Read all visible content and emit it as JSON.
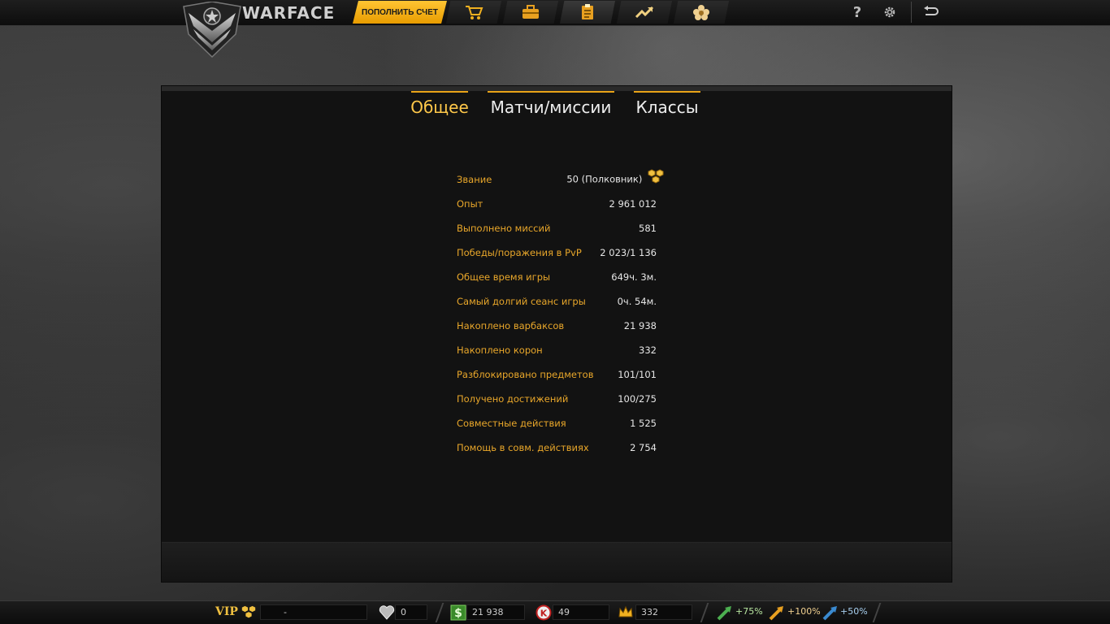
{
  "header": {
    "logo_text": "WARFACE",
    "topup_label": "ПОПОЛНИТЬ СЧЕТ",
    "nav_icons": [
      "cart-icon",
      "toolbox-icon",
      "clipboard-icon",
      "trend-icon",
      "flower-icon"
    ],
    "help_label": "?",
    "accent_color": "#f5a800"
  },
  "tabs": [
    {
      "label": "Общее",
      "active": true
    },
    {
      "label": "Матчи/миссии",
      "active": false
    },
    {
      "label": "Классы",
      "active": false
    }
  ],
  "stats": [
    {
      "label": "Звание",
      "value": "50 (Полковник)"
    },
    {
      "label": "Опыт",
      "value": "2 961 012"
    },
    {
      "label": "Выполнено миссий",
      "value": "581"
    },
    {
      "label": "Победы/поражения в PvP",
      "value": "2 023/1 136"
    },
    {
      "label": "Общее время игры",
      "value": "649ч. 3м."
    },
    {
      "label": "Самый долгий сеанс игры",
      "value": "0ч. 54м."
    },
    {
      "label": "Накоплено варбаксов",
      "value": "21 938"
    },
    {
      "label": "Накоплено корон",
      "value": "332"
    },
    {
      "label": "Разблокировано предметов",
      "value": "101/101"
    },
    {
      "label": "Получено достижений",
      "value": "100/275"
    },
    {
      "label": "Совместные действия",
      "value": "1 525"
    },
    {
      "label": "Помощь в совм. действиях",
      "value": "2 754"
    }
  ],
  "bottom": {
    "vip_label": "VIP",
    "vip_value": "-",
    "heart_value": "0",
    "warbucks_value": "21 938",
    "k_value": "49",
    "crowns_value": "332",
    "boost_exp": "+75%",
    "boost_money": "+100%",
    "boost_sp": "+50%"
  }
}
